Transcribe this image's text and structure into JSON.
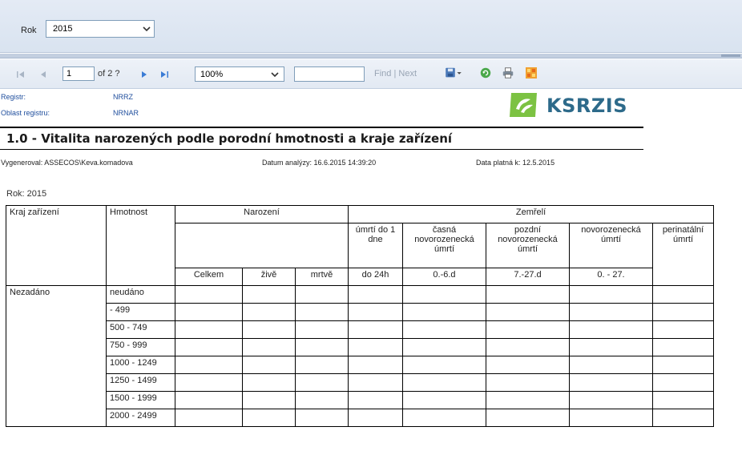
{
  "params": {
    "rok_label": "Rok",
    "rok_value": "2015"
  },
  "toolbar": {
    "first_icon": "first-page-icon",
    "prev_icon": "previous-page-icon",
    "page_value": "1",
    "page_of": "of 2 ?",
    "next_icon": "next-page-icon",
    "last_icon": "last-page-icon",
    "zoom_value": "100%",
    "find_value": "",
    "find_label": "Find",
    "find_sep": " | ",
    "next_label": "Next",
    "export_icon": "save-export-icon",
    "refresh_icon": "refresh-icon",
    "print_icon": "print-icon",
    "layout_icon": "layout-icon"
  },
  "report": {
    "registr_label": "Registr:",
    "registr_value": "NRRZ",
    "oblast_label": "Oblast registru:",
    "oblast_value": "NRNAR",
    "logo_text": "KSRZIS",
    "title": "1.0 - Vitalita narozených podle porodní hmotnosti a kraje zařízení",
    "generated": "Vygeneroval: ASSECOS\\Keva.komadova",
    "analysis_date": "Datum analýzy: 16.6.2015 14:39:20",
    "valid_date": "Data platná k:  12.5.2015",
    "rok_line": "Rok: 2015"
  },
  "table": {
    "h_kraj": "Kraj zařízení",
    "h_hmotnost": "Hmotnost",
    "h_narozeni": "Narození",
    "h_zemreli": "Zemřelí",
    "h_umrti1": "úmrtí do 1 dne",
    "h_casna": "časná novorozenecká úmrtí",
    "h_pozdni": "pozdní novorozenecká úmrtí",
    "h_novor": "novorozenecká úmrtí",
    "h_perinat": "perinatální úmrtí",
    "h_celkem": "Celkem",
    "h_zive": "živě",
    "h_mrtve": "mrtvě",
    "h_do24": "do 24h",
    "h_06": "0.-6.d",
    "h_727": "7.-27.d",
    "h_027": "0. - 27.",
    "kraj": "Nezadáno",
    "weights": [
      "neudáno",
      "- 499",
      "500 - 749",
      "750 - 999",
      "1000 - 1249",
      "1250 - 1499",
      "1500 - 1999",
      "2000 - 2499"
    ]
  },
  "colors": {
    "accent": "#2d6a8a",
    "link": "#1f4e9d"
  }
}
